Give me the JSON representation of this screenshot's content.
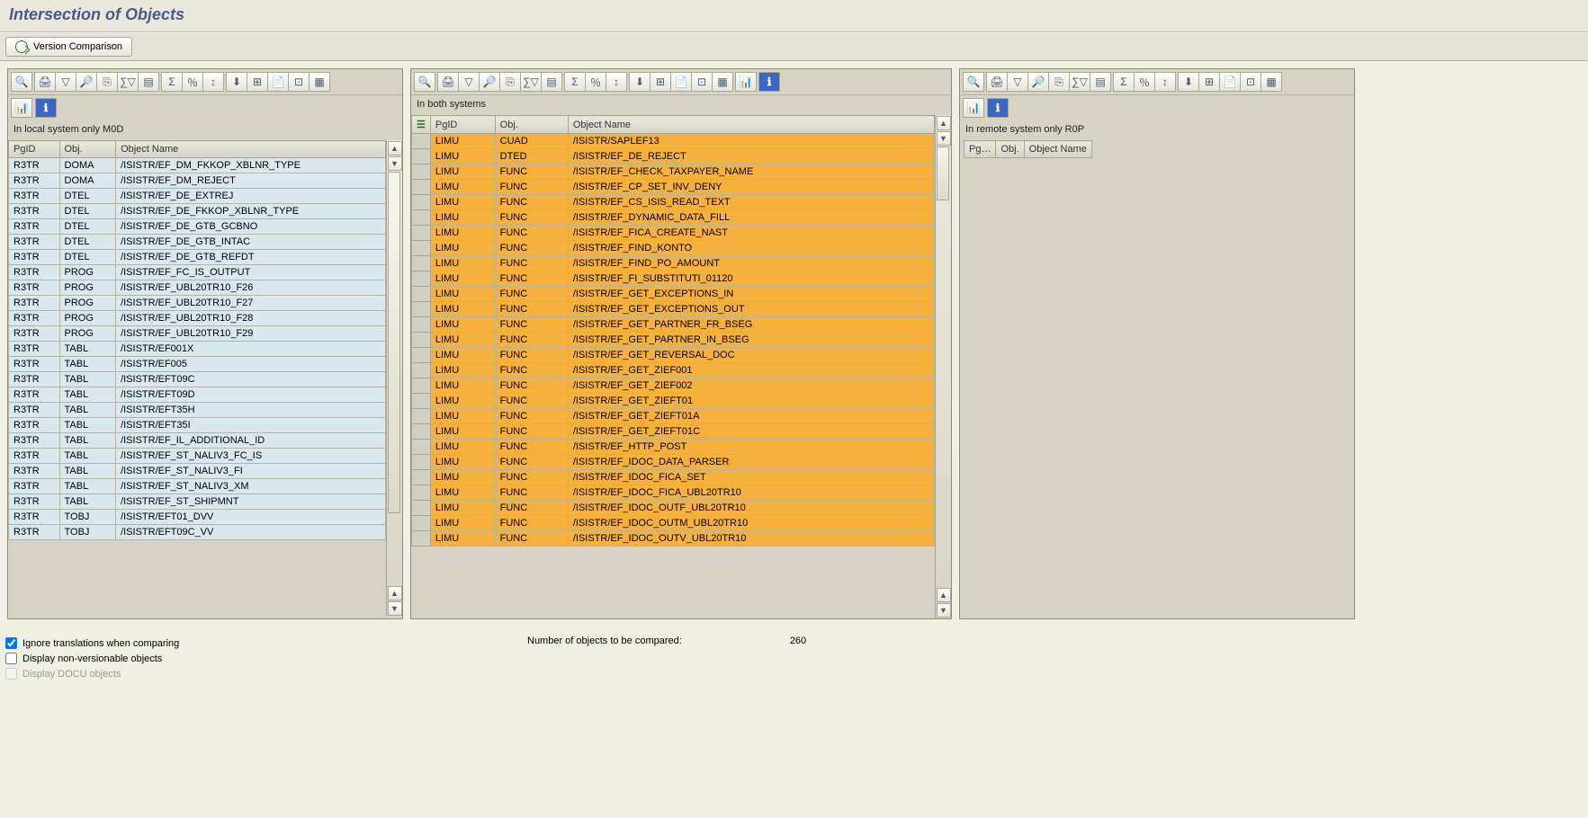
{
  "title": "Intersection of Objects",
  "versionComparisonLabel": "Version Comparison",
  "panels": {
    "left": {
      "label": "In local system only  M0D",
      "headers": [
        "PgID",
        "Obj.",
        "Object Name"
      ],
      "rows": [
        {
          "pg": "R3TR",
          "obj": "DOMA",
          "name": "/ISISTR/EF_DM_FKKOP_XBLNR_TYPE"
        },
        {
          "pg": "R3TR",
          "obj": "DOMA",
          "name": "/ISISTR/EF_DM_REJECT"
        },
        {
          "pg": "R3TR",
          "obj": "DTEL",
          "name": "/ISISTR/EF_DE_EXTREJ"
        },
        {
          "pg": "R3TR",
          "obj": "DTEL",
          "name": "/ISISTR/EF_DE_FKKOP_XBLNR_TYPE"
        },
        {
          "pg": "R3TR",
          "obj": "DTEL",
          "name": "/ISISTR/EF_DE_GTB_GCBNO"
        },
        {
          "pg": "R3TR",
          "obj": "DTEL",
          "name": "/ISISTR/EF_DE_GTB_INTAC"
        },
        {
          "pg": "R3TR",
          "obj": "DTEL",
          "name": "/ISISTR/EF_DE_GTB_REFDT"
        },
        {
          "pg": "R3TR",
          "obj": "PROG",
          "name": "/ISISTR/EF_FC_IS_OUTPUT"
        },
        {
          "pg": "R3TR",
          "obj": "PROG",
          "name": "/ISISTR/EF_UBL20TR10_F26"
        },
        {
          "pg": "R3TR",
          "obj": "PROG",
          "name": "/ISISTR/EF_UBL20TR10_F27"
        },
        {
          "pg": "R3TR",
          "obj": "PROG",
          "name": "/ISISTR/EF_UBL20TR10_F28"
        },
        {
          "pg": "R3TR",
          "obj": "PROG",
          "name": "/ISISTR/EF_UBL20TR10_F29"
        },
        {
          "pg": "R3TR",
          "obj": "TABL",
          "name": "/ISISTR/EF001X"
        },
        {
          "pg": "R3TR",
          "obj": "TABL",
          "name": "/ISISTR/EF005"
        },
        {
          "pg": "R3TR",
          "obj": "TABL",
          "name": "/ISISTR/EFT09C"
        },
        {
          "pg": "R3TR",
          "obj": "TABL",
          "name": "/ISISTR/EFT09D"
        },
        {
          "pg": "R3TR",
          "obj": "TABL",
          "name": "/ISISTR/EFT35H"
        },
        {
          "pg": "R3TR",
          "obj": "TABL",
          "name": "/ISISTR/EFT35I"
        },
        {
          "pg": "R3TR",
          "obj": "TABL",
          "name": "/ISISTR/EF_IL_ADDITIONAL_ID"
        },
        {
          "pg": "R3TR",
          "obj": "TABL",
          "name": "/ISISTR/EF_ST_NALIV3_FC_IS"
        },
        {
          "pg": "R3TR",
          "obj": "TABL",
          "name": "/ISISTR/EF_ST_NALIV3_FI"
        },
        {
          "pg": "R3TR",
          "obj": "TABL",
          "name": "/ISISTR/EF_ST_NALIV3_XM"
        },
        {
          "pg": "R3TR",
          "obj": "TABL",
          "name": "/ISISTR/EF_ST_SHIPMNT"
        },
        {
          "pg": "R3TR",
          "obj": "TOBJ",
          "name": "/ISISTR/EFT01_DVV"
        },
        {
          "pg": "R3TR",
          "obj": "TOBJ",
          "name": "/ISISTR/EFT09C_VV"
        }
      ]
    },
    "mid": {
      "label": "In both systems",
      "headers": [
        "PgID",
        "Obj.",
        "Object Name"
      ],
      "rows": [
        {
          "pg": "LIMU",
          "obj": "CUAD",
          "name": "/ISISTR/SAPLEF13"
        },
        {
          "pg": "LIMU",
          "obj": "DTED",
          "name": "/ISISTR/EF_DE_REJECT"
        },
        {
          "pg": "LIMU",
          "obj": "FUNC",
          "name": "/ISISTR/EF_CHECK_TAXPAYER_NAME"
        },
        {
          "pg": "LIMU",
          "obj": "FUNC",
          "name": "/ISISTR/EF_CP_SET_INV_DENY"
        },
        {
          "pg": "LIMU",
          "obj": "FUNC",
          "name": "/ISISTR/EF_CS_ISIS_READ_TEXT"
        },
        {
          "pg": "LIMU",
          "obj": "FUNC",
          "name": "/ISISTR/EF_DYNAMIC_DATA_FILL"
        },
        {
          "pg": "LIMU",
          "obj": "FUNC",
          "name": "/ISISTR/EF_FICA_CREATE_NAST"
        },
        {
          "pg": "LIMU",
          "obj": "FUNC",
          "name": "/ISISTR/EF_FIND_KONTO"
        },
        {
          "pg": "LIMU",
          "obj": "FUNC",
          "name": "/ISISTR/EF_FIND_PO_AMOUNT"
        },
        {
          "pg": "LIMU",
          "obj": "FUNC",
          "name": "/ISISTR/EF_FI_SUBSTITUTI_01120"
        },
        {
          "pg": "LIMU",
          "obj": "FUNC",
          "name": "/ISISTR/EF_GET_EXCEPTIONS_IN"
        },
        {
          "pg": "LIMU",
          "obj": "FUNC",
          "name": "/ISISTR/EF_GET_EXCEPTIONS_OUT"
        },
        {
          "pg": "LIMU",
          "obj": "FUNC",
          "name": "/ISISTR/EF_GET_PARTNER_FR_BSEG"
        },
        {
          "pg": "LIMU",
          "obj": "FUNC",
          "name": "/ISISTR/EF_GET_PARTNER_IN_BSEG"
        },
        {
          "pg": "LIMU",
          "obj": "FUNC",
          "name": "/ISISTR/EF_GET_REVERSAL_DOC"
        },
        {
          "pg": "LIMU",
          "obj": "FUNC",
          "name": "/ISISTR/EF_GET_ZIEF001"
        },
        {
          "pg": "LIMU",
          "obj": "FUNC",
          "name": "/ISISTR/EF_GET_ZIEF002"
        },
        {
          "pg": "LIMU",
          "obj": "FUNC",
          "name": "/ISISTR/EF_GET_ZIEFT01"
        },
        {
          "pg": "LIMU",
          "obj": "FUNC",
          "name": "/ISISTR/EF_GET_ZIEFT01A"
        },
        {
          "pg": "LIMU",
          "obj": "FUNC",
          "name": "/ISISTR/EF_GET_ZIEFT01C"
        },
        {
          "pg": "LIMU",
          "obj": "FUNC",
          "name": "/ISISTR/EF_HTTP_POST"
        },
        {
          "pg": "LIMU",
          "obj": "FUNC",
          "name": "/ISISTR/EF_IDOC_DATA_PARSER"
        },
        {
          "pg": "LIMU",
          "obj": "FUNC",
          "name": "/ISISTR/EF_IDOC_FICA_SET"
        },
        {
          "pg": "LIMU",
          "obj": "FUNC",
          "name": "/ISISTR/EF_IDOC_FICA_UBL20TR10"
        },
        {
          "pg": "LIMU",
          "obj": "FUNC",
          "name": "/ISISTR/EF_IDOC_OUTF_UBL20TR10"
        },
        {
          "pg": "LIMU",
          "obj": "FUNC",
          "name": "/ISISTR/EF_IDOC_OUTM_UBL20TR10"
        },
        {
          "pg": "LIMU",
          "obj": "FUNC",
          "name": "/ISISTR/EF_IDOC_OUTV_UBL20TR10"
        }
      ]
    },
    "right": {
      "label": "In remote system only  R0P",
      "headers": [
        "Pg…",
        "Obj.",
        "Object Name"
      ],
      "rows": []
    }
  },
  "footer": {
    "chk1": "Ignore translations when comparing",
    "chk2": "Display non-versionable objects",
    "chk3": "Display DOCU objects",
    "countLabel": "Number of objects to be compared:",
    "countValue": "260"
  },
  "icons": {
    "detail": "🔍",
    "print": "🖨",
    "filter": "▽",
    "find": "🔎",
    "findnext": "⎘",
    "setfilter": "∑▽",
    "layout": "▤",
    "sum": "Σ",
    "subtotal": "％",
    "sort": "↕",
    "export": "⬇",
    "exportspread": "⊞",
    "exportword": "📄",
    "views": "⊡",
    "grid": "▦",
    "chart": "📊",
    "info": "ℹ",
    "select": "☰"
  }
}
